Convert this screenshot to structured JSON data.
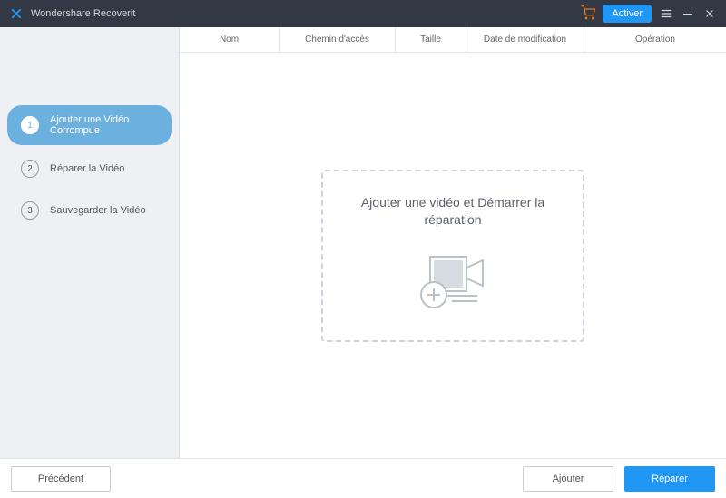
{
  "titlebar": {
    "app_name": "Wondershare Recoverit",
    "activate_label": "Activer"
  },
  "sidebar": {
    "steps": [
      {
        "num": "1",
        "label": "Ajouter une Vidéo Corrompue"
      },
      {
        "num": "2",
        "label": "Réparer la Vidéo"
      },
      {
        "num": "3",
        "label": "Sauvegarder la Vidéo"
      }
    ]
  },
  "table": {
    "columns": {
      "name": "Nom",
      "path": "Chemin d'accès",
      "size": "Taille",
      "date": "Date de modification",
      "op": "Opération"
    }
  },
  "dropzone": {
    "title": "Ajouter une vidéo et Démarrer la réparation"
  },
  "footer": {
    "prev": "Précédent",
    "add": "Ajouter",
    "repair": "Réparer"
  }
}
